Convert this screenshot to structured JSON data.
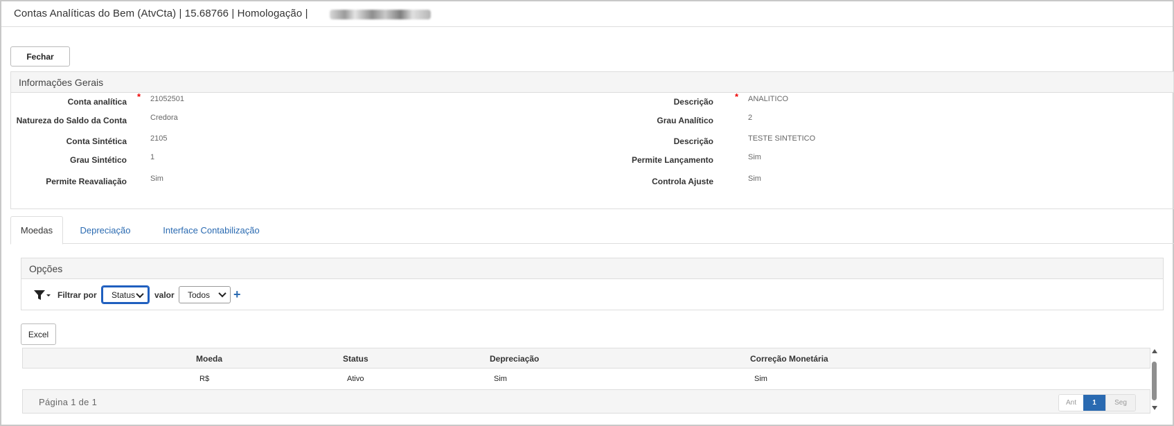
{
  "window": {
    "title": "Contas Analíticas do Bem (AtvCta) | 15.68766 | Homologação |"
  },
  "toolbar": {
    "close_label": "Fechar"
  },
  "info": {
    "title": "Informações Gerais",
    "left": [
      {
        "label": "Conta analítica",
        "value": "21052501",
        "required": "*"
      },
      {
        "label": "Natureza do Saldo da Conta",
        "value": "Credora"
      },
      {
        "label": "Conta Sintética",
        "value": "2105"
      },
      {
        "label": "Grau Sintético",
        "value": "1"
      },
      {
        "label": "Permite Reavaliação",
        "value": "Sim"
      }
    ],
    "right": [
      {
        "label": "Descrição",
        "value": "ANALITICO",
        "required": "*"
      },
      {
        "label": "Grau Analítico",
        "value": "2"
      },
      {
        "label": "Descrição",
        "value": "TESTE SINTETICO"
      },
      {
        "label": "Permite Lançamento",
        "value": "Sim"
      },
      {
        "label": "Controla Ajuste",
        "value": "Sim"
      }
    ]
  },
  "tabs": [
    {
      "label": "Moedas",
      "active": true
    },
    {
      "label": "Depreciação"
    },
    {
      "label": "Interface Contabilização"
    }
  ],
  "options": {
    "title": "Opções",
    "filter_label": "Filtrar por",
    "filter_select": "Status",
    "value_label": "valor",
    "value_select": "Todos",
    "add_symbol": "+"
  },
  "excel_label": "Excel",
  "table": {
    "columns": [
      "Moeda",
      "Status",
      "Depreciação",
      "Correção Monetária"
    ],
    "rows": [
      [
        "R$",
        "Ativo",
        "Sim",
        "Sim"
      ]
    ]
  },
  "pagination": {
    "info": "Página 1 de 1",
    "prev": "Ant",
    "current": "1",
    "next": "Seg"
  }
}
